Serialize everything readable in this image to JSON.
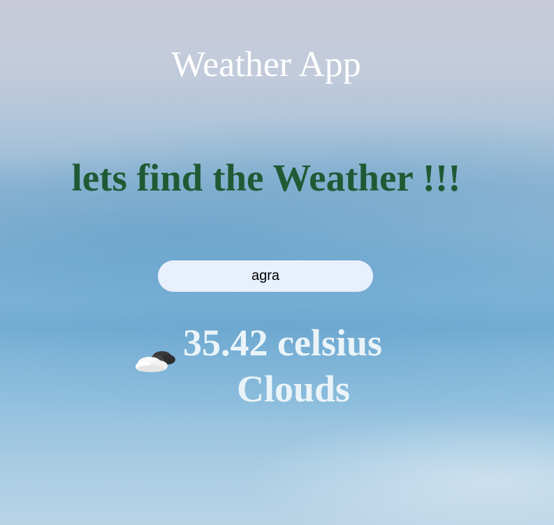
{
  "header": {
    "app_title": "Weather App",
    "tagline": "lets find the Weather !!!"
  },
  "search": {
    "value": "agra"
  },
  "weather": {
    "temperature": "35.42 celsius",
    "condition": "Clouds",
    "icon": "cloud-icon"
  },
  "colors": {
    "tagline": "#1f5a34",
    "title": "#ffffff",
    "result_text": "#eaf4f8",
    "input_background": "#e8f0fe"
  }
}
